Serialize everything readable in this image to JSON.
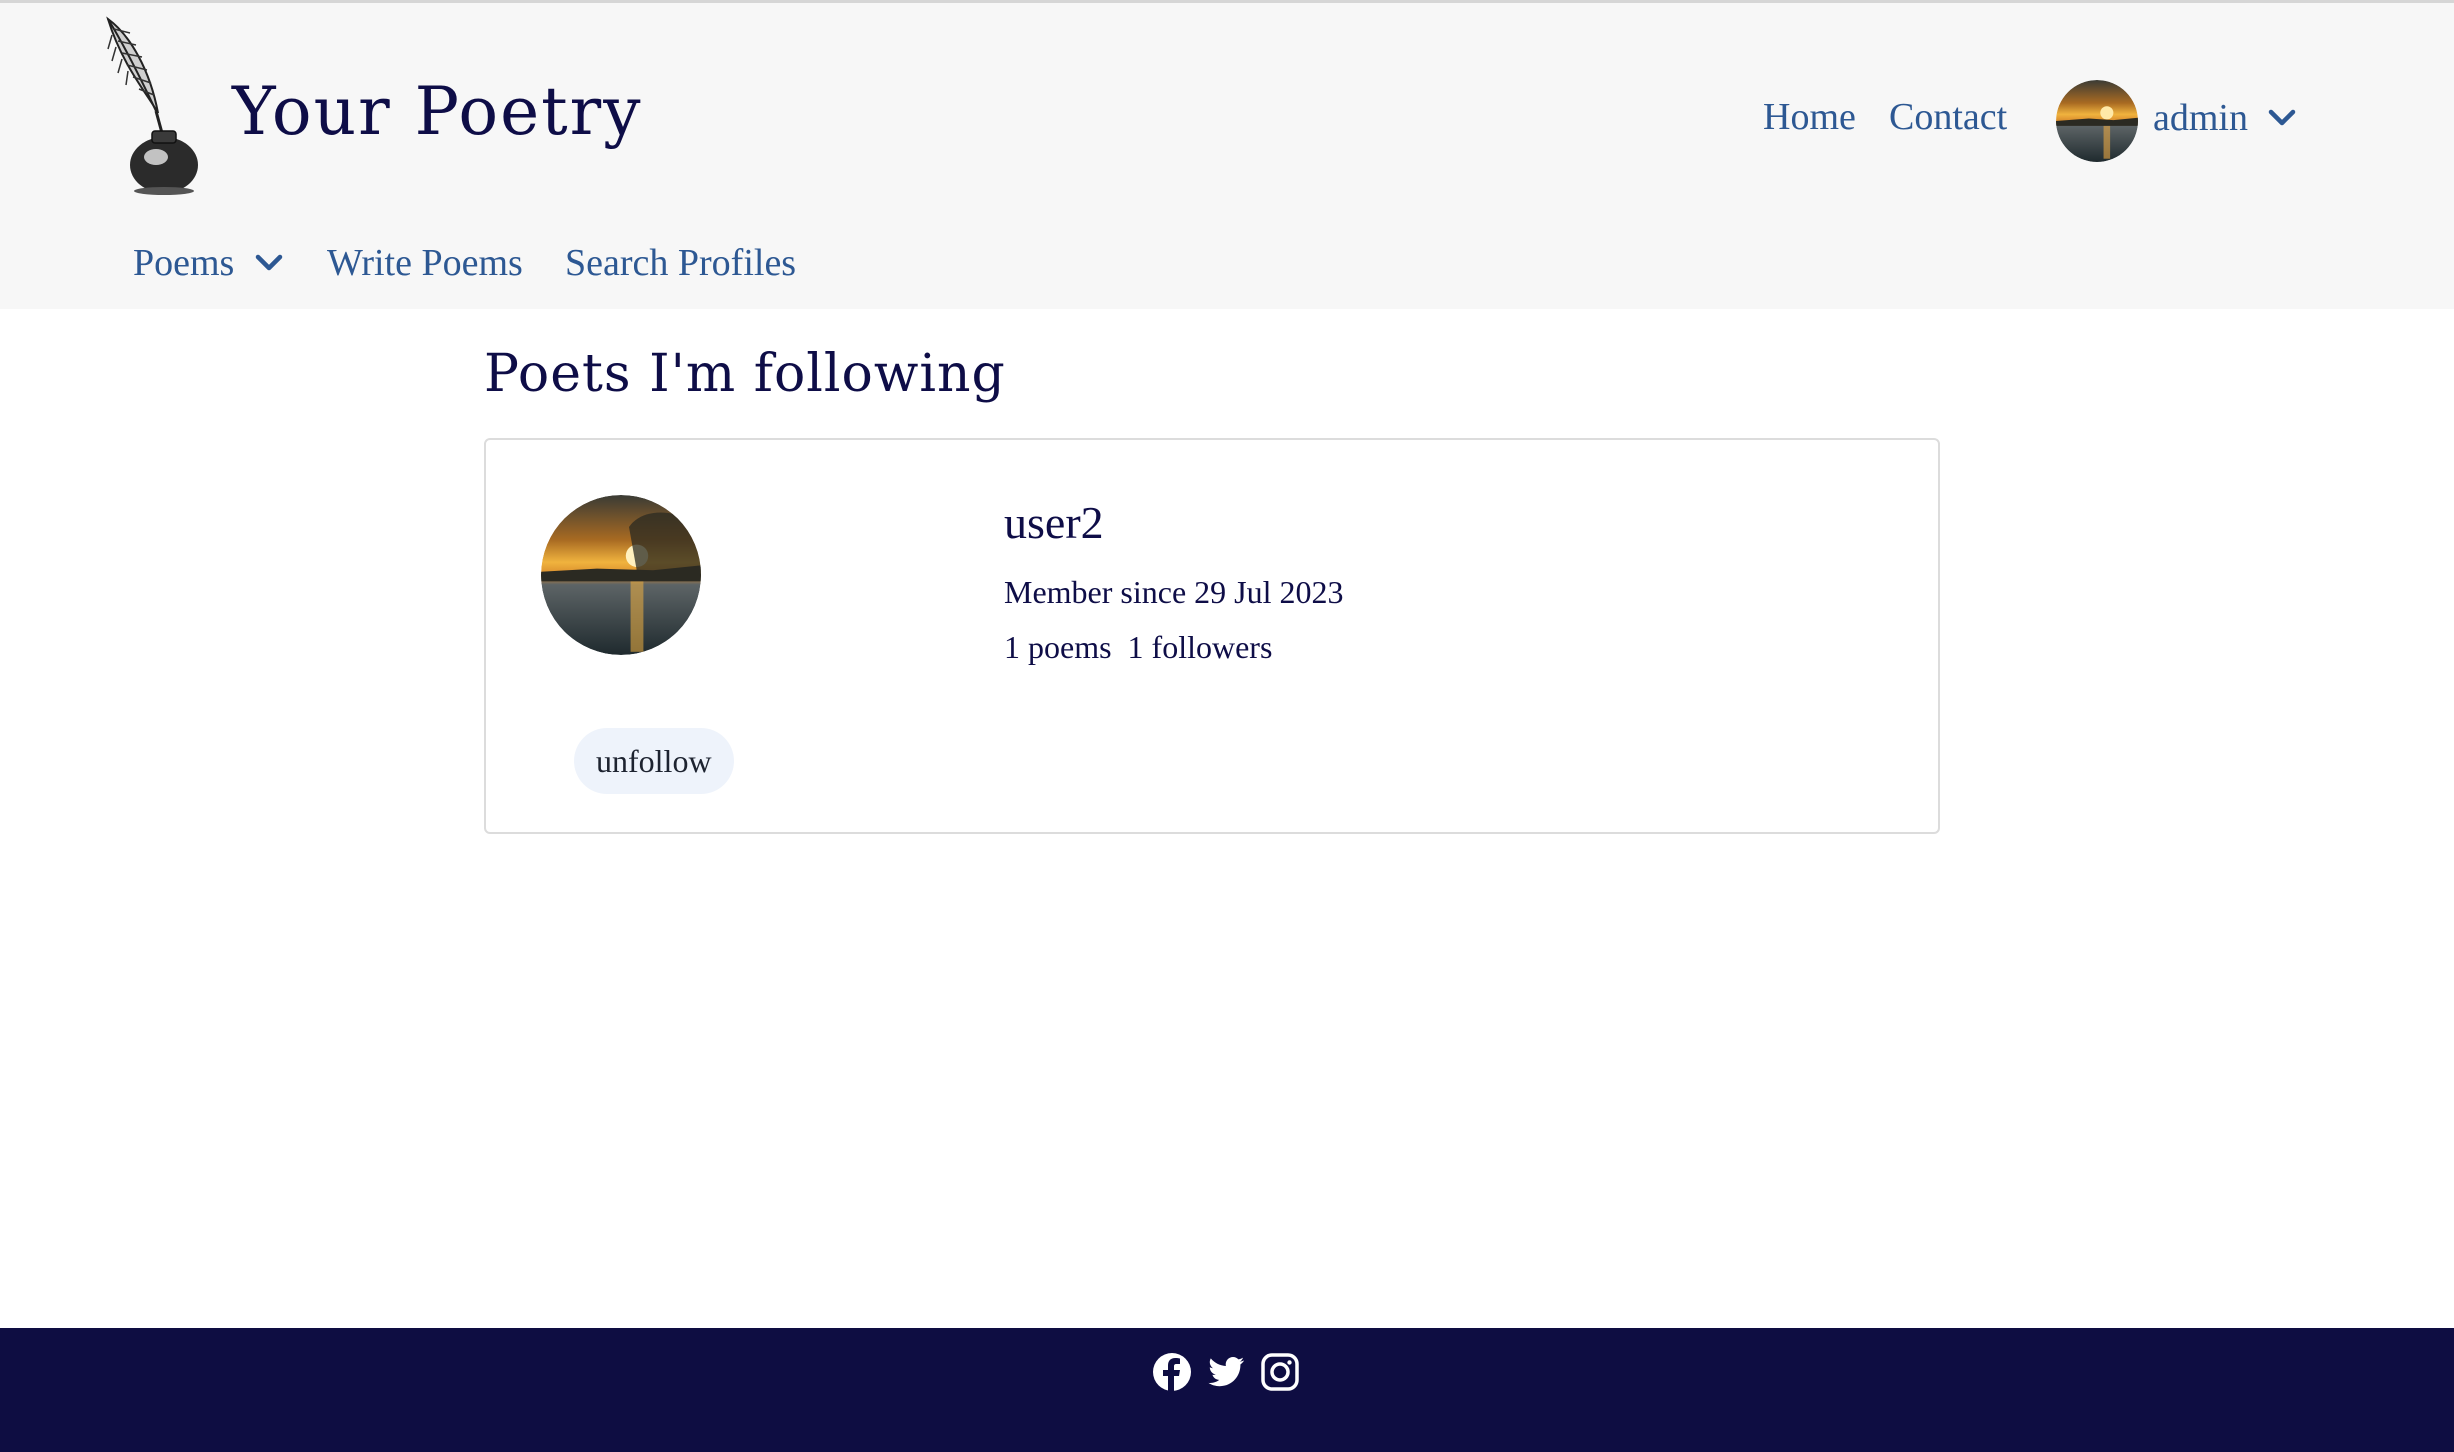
{
  "header": {
    "brand": "Your Poetry",
    "nav_right": {
      "home": "Home",
      "contact": "Contact",
      "user": "admin"
    },
    "nav_sub": {
      "poems": "Poems",
      "write": "Write Poems",
      "search": "Search Profiles"
    }
  },
  "main": {
    "title": "Poets I'm following",
    "following": [
      {
        "username": "user2",
        "member_since": "Member since 29 Jul 2023",
        "stats": "1 poems  1 followers",
        "action": "unfollow"
      }
    ]
  },
  "footer": {
    "social_icons": [
      "facebook-icon",
      "twitter-icon",
      "instagram-icon"
    ]
  },
  "colors": {
    "brand": "#0e0d47",
    "link": "#2d5893",
    "header_bg": "#f7f7f7",
    "footer_bg": "#0e0d42"
  }
}
